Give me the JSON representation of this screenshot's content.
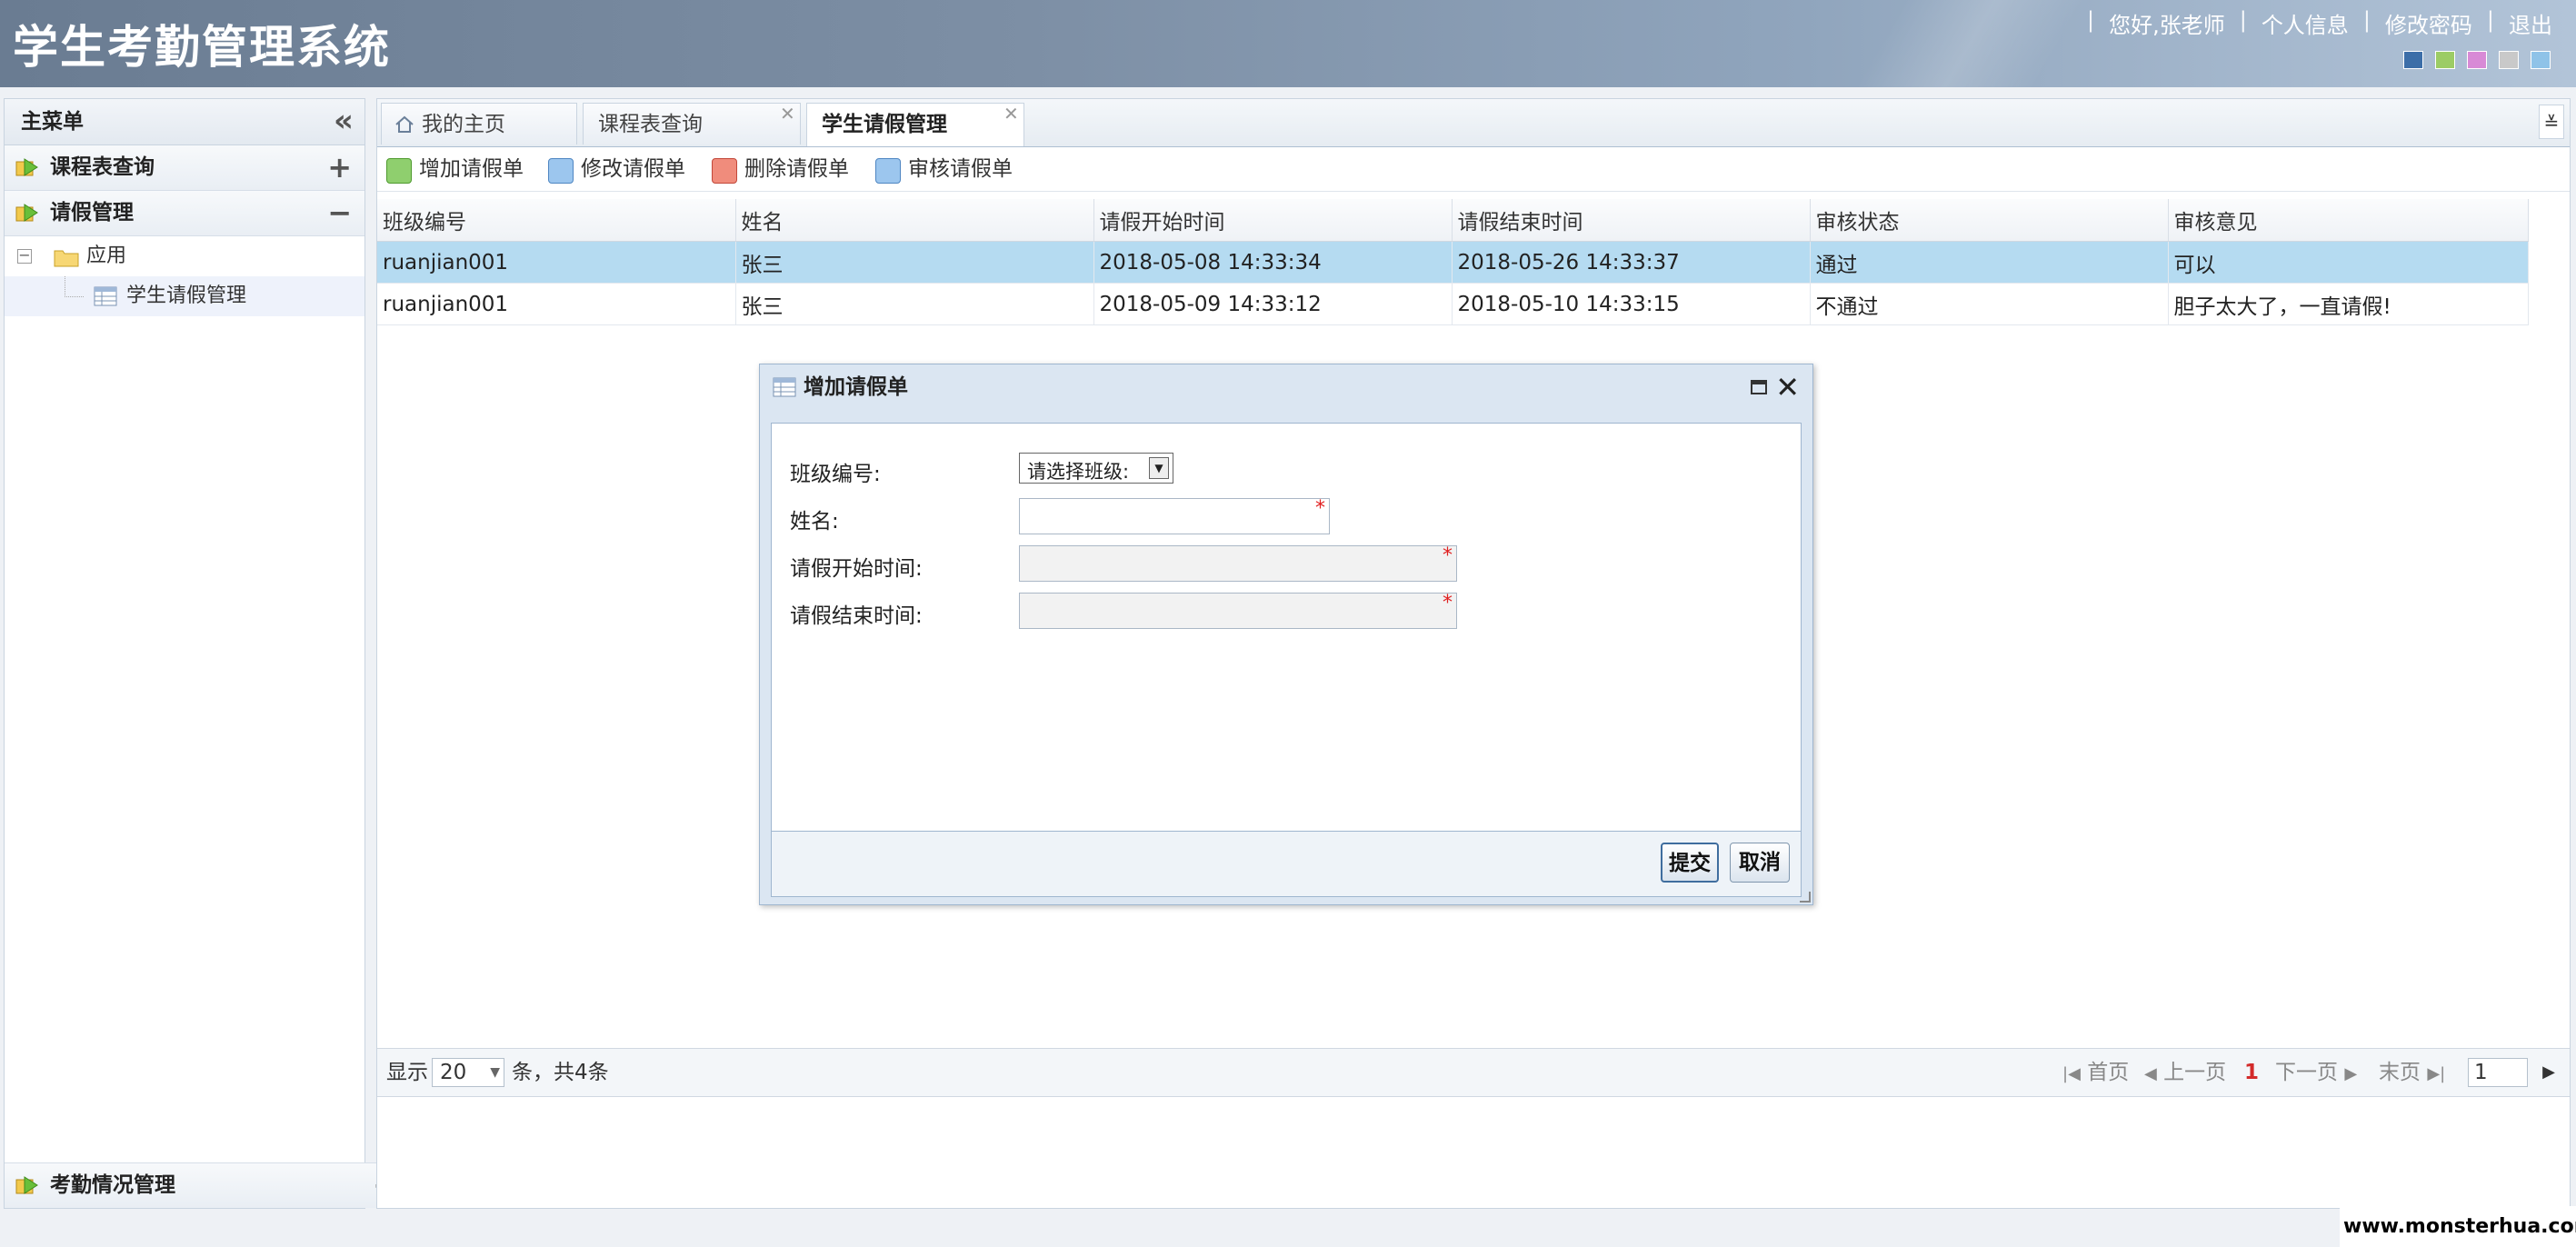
{
  "header": {
    "title": "学生考勤管理系统",
    "greeting": "您好,张老师",
    "links": [
      "个人信息",
      "修改密码",
      "退出"
    ],
    "theme_colors": [
      "#3c6ea8",
      "#9ccc65",
      "#d88ad6",
      "#c9c9c9",
      "#8fc3e8"
    ]
  },
  "sidebar": {
    "title": "主菜单",
    "panels": [
      {
        "label": "课程表查询",
        "toggle": "+"
      },
      {
        "label": "请假管理",
        "toggle": "−"
      },
      {
        "label": "考勤情况管理",
        "toggle": "+"
      }
    ],
    "tree": {
      "folder": "应用",
      "item": "学生请假管理"
    }
  },
  "tabs": [
    {
      "label": "我的主页",
      "closable": false
    },
    {
      "label": "课程表查询",
      "closable": true
    },
    {
      "label": "学生请假管理",
      "closable": true,
      "active": true
    }
  ],
  "toolbar": {
    "add": "增加请假单",
    "edit": "修改请假单",
    "delete": "删除请假单",
    "review": "审核请假单"
  },
  "grid": {
    "columns": [
      "班级编号",
      "姓名",
      "请假开始时间",
      "请假结束时间",
      "审核状态",
      "审核意见"
    ],
    "rows": [
      [
        "ruanjian001",
        "张三",
        "2018-05-08 14:33:34",
        "2018-05-26 14:33:37",
        "通过",
        "可以"
      ],
      [
        "ruanjian001",
        "张三",
        "2018-05-09 14:33:12",
        "2018-05-10 14:33:15",
        "不通过",
        "胆子太大了，一直请假!"
      ]
    ],
    "selected_row": 0
  },
  "pager": {
    "show": "显示",
    "page_size": "20",
    "summary": "条，共4条",
    "first": "首页",
    "prev": "上一页",
    "current": "1",
    "next": "下一页",
    "last": "末页",
    "goto": "1"
  },
  "dialog": {
    "title": "增加请假单",
    "fields": [
      {
        "label": "班级编号:",
        "value": "请选择班级:"
      },
      {
        "label": "姓名:",
        "value": ""
      },
      {
        "label": "请假开始时间:",
        "value": ""
      },
      {
        "label": "请假结束时间:",
        "value": ""
      }
    ],
    "required_mark": "*",
    "submit": "提交",
    "cancel": "取消"
  },
  "watermark": "www.monsterhua.com"
}
